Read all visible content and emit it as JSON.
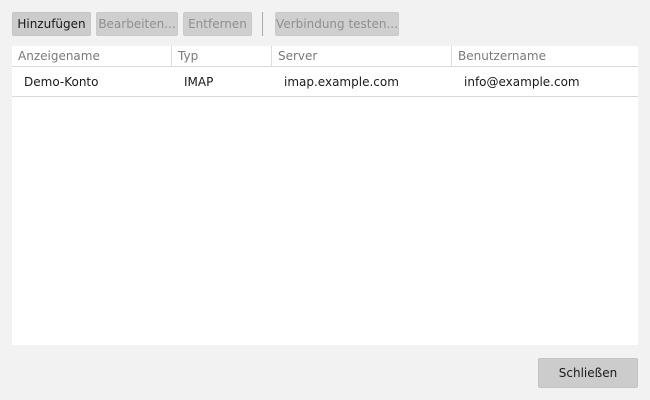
{
  "toolbar": {
    "add_label": "Hinzufügen",
    "edit_label": "Bearbeiten...",
    "remove_label": "Entfernen",
    "test_label": "Verbindung testen..."
  },
  "table": {
    "columns": [
      "Anzeigename",
      "Typ",
      "Server",
      "Benutzername"
    ],
    "rows": [
      {
        "display_name": "Demo-Konto",
        "type": "IMAP",
        "server": "imap.example.com",
        "username": "info@example.com"
      }
    ]
  },
  "footer": {
    "close_label": "Schließen"
  }
}
